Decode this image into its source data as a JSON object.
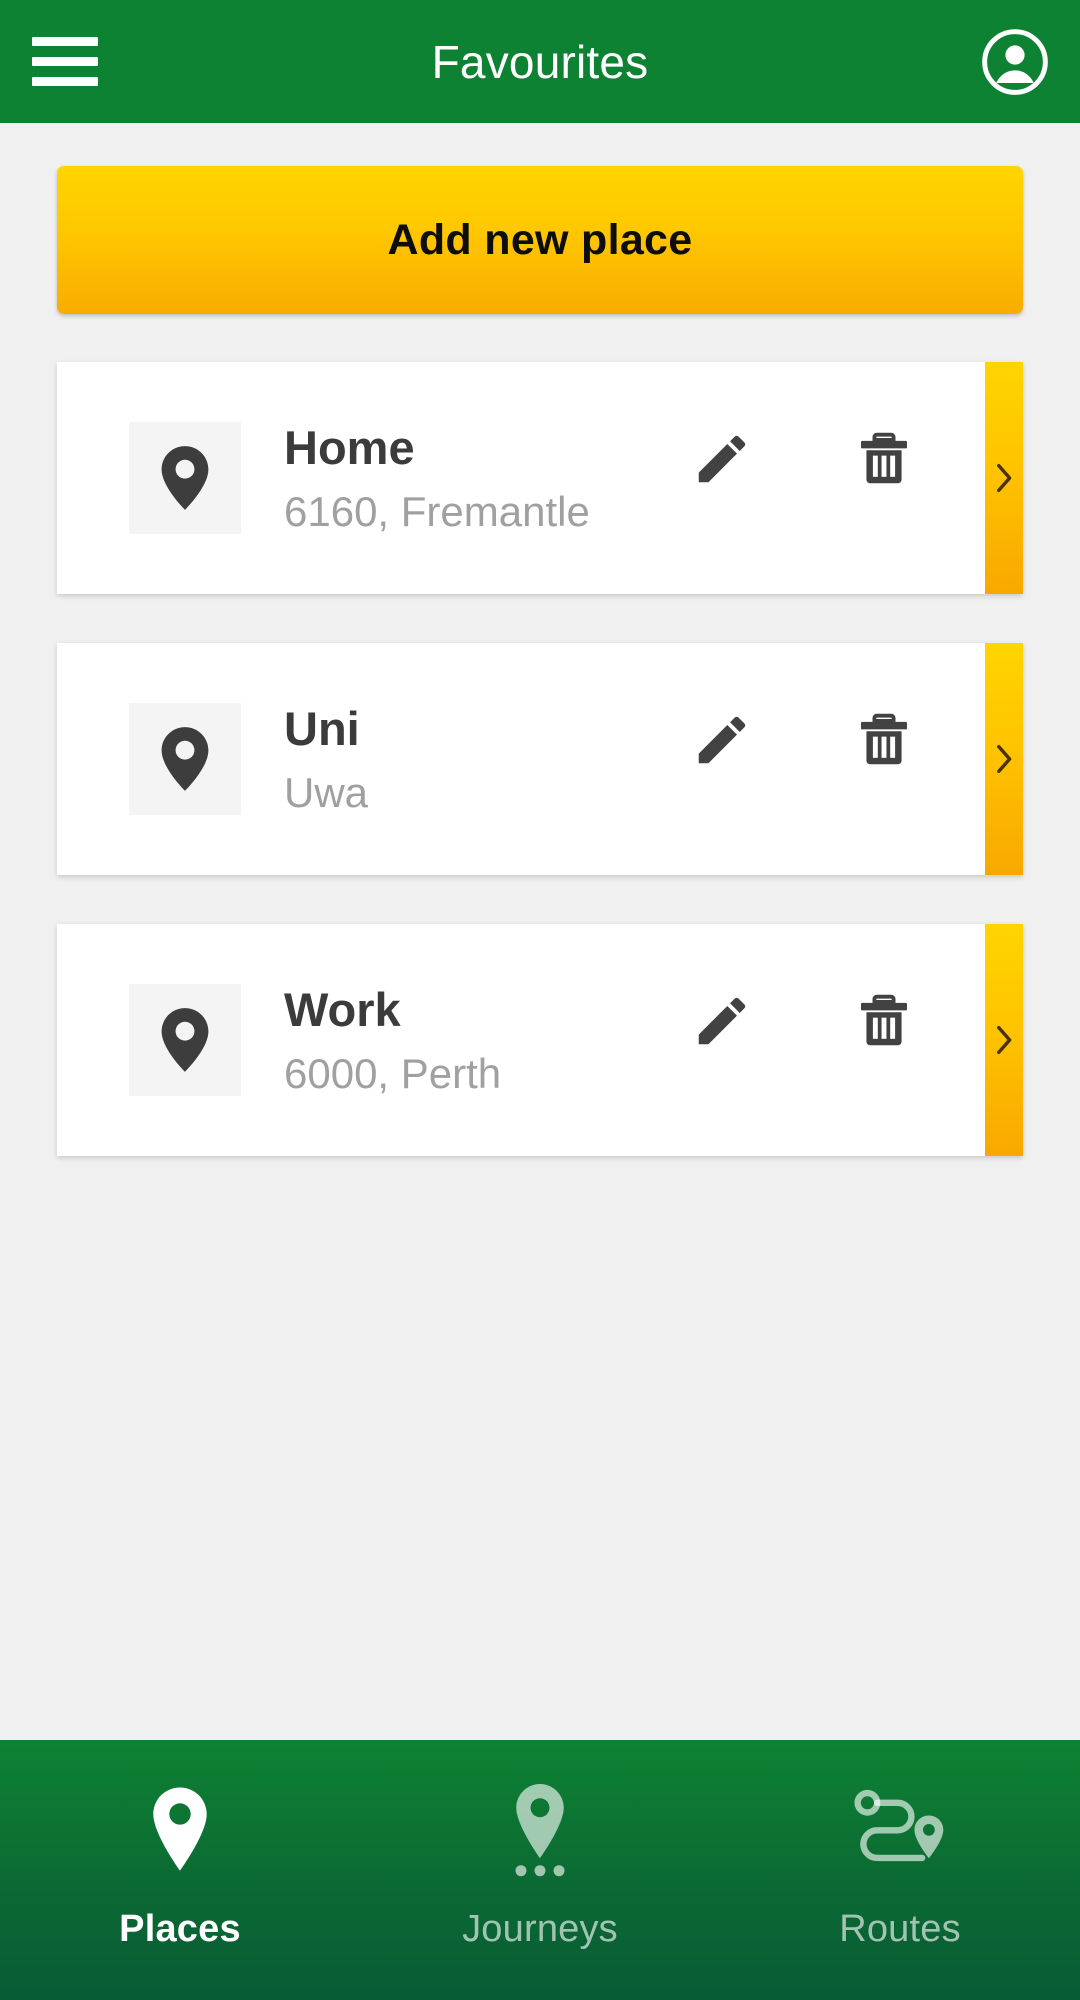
{
  "header": {
    "title": "Favourites",
    "menu_icon": "hamburger-menu-icon",
    "account_icon": "account-circle-icon",
    "background_color": "#0e8233"
  },
  "main": {
    "add_button": {
      "label": "Add new place",
      "gradient_from": "#ffd400",
      "gradient_to": "#f9ac00",
      "text_color": "#0d0d0d"
    },
    "places": [
      {
        "name": "Home",
        "address": "6160, Fremantle",
        "pin_icon": "map-pin-icon",
        "edit_icon": "pencil-icon",
        "delete_icon": "trash-icon",
        "chevron_icon": "chevron-right-icon"
      },
      {
        "name": "Uni",
        "address": "Uwa",
        "pin_icon": "map-pin-icon",
        "edit_icon": "pencil-icon",
        "delete_icon": "trash-icon",
        "chevron_icon": "chevron-right-icon"
      },
      {
        "name": "Work",
        "address": "6000, Perth",
        "pin_icon": "map-pin-icon",
        "edit_icon": "pencil-icon",
        "delete_icon": "trash-icon",
        "chevron_icon": "chevron-right-icon"
      }
    ]
  },
  "bottom_nav": {
    "items": [
      {
        "label": "Places",
        "icon": "map-pin-icon",
        "active": true
      },
      {
        "label": "Journeys",
        "icon": "pin-with-dots-icon",
        "active": false
      },
      {
        "label": "Routes",
        "icon": "route-path-icon",
        "active": false
      }
    ],
    "gradient_from": "#0e8233",
    "gradient_to": "#085b35"
  },
  "colors": {
    "brand_green": "#0e8233",
    "accent_yellow": "#ffc800",
    "page_background": "#f0f0f0",
    "card_background": "#ffffff",
    "title_text": "#3b3b3b",
    "subtitle_text": "#a0a0a0"
  }
}
